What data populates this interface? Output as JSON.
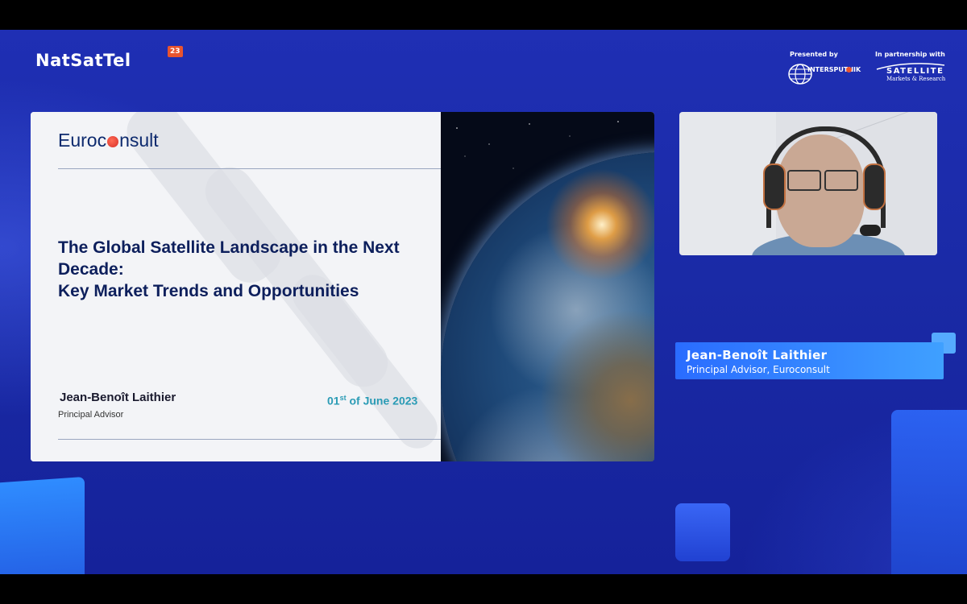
{
  "event": {
    "logo_text": "NatSatTel",
    "logo_badge": "23",
    "presented_by_label": "Presented by",
    "presented_by_name": "INTERSPUTNIK",
    "partnership_label": "In partnership with",
    "partner_name": "SATELLITE",
    "partner_tagline": "Markets & Research"
  },
  "slide": {
    "company_logo_prefix": "Euroc",
    "company_logo_suffix": "nsult",
    "title_lines": [
      "The Global Satellite Landscape in the Next",
      "Decade:",
      "Key Market Trends and Opportunities"
    ],
    "presenter_name": "Jean-Benoît Laithier",
    "presenter_role": "Principal Advisor",
    "date_day": "01",
    "date_suffix": "st",
    "date_rest": " of June 2023"
  },
  "lower_third": {
    "name": "Jean-Benoît Laithier",
    "role": "Principal Advisor, Euroconsult"
  },
  "colors": {
    "background": "#1f2fb4",
    "accent_orange": "#e8542f",
    "slide_title": "#0d1f5c",
    "date": "#2a9bb5",
    "name_card": "#2a6cff"
  }
}
